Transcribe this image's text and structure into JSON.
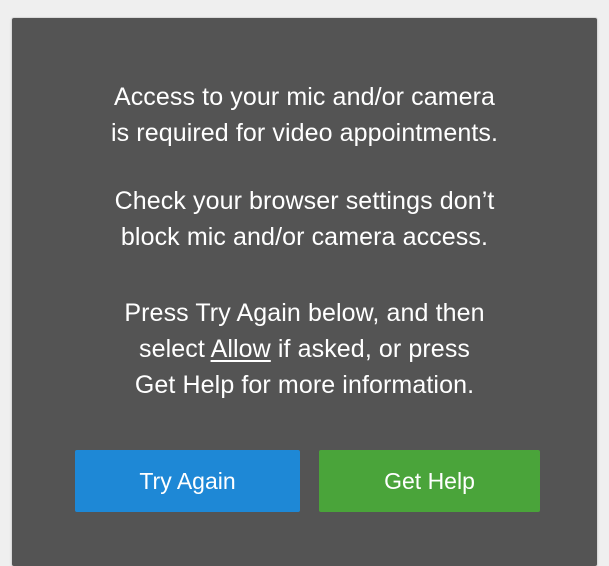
{
  "dialog": {
    "paragraph1": {
      "line1": "Access to your mic and/or camera",
      "line2": "is required for video appointments."
    },
    "paragraph2": {
      "line1": "Check your browser settings don’t",
      "line2": "block mic and/or camera access."
    },
    "paragraph3": {
      "line1": "Press Try Again below, and then",
      "line2_prefix": "select ",
      "allow_link": "Allow",
      "line2_suffix": " if asked, or press",
      "line3": "Get Help for more information."
    },
    "buttons": {
      "try_again": "Try Again",
      "get_help": "Get Help"
    }
  },
  "colors": {
    "dialog_background": "#545454",
    "try_again_button": "#1e88d6",
    "get_help_button": "#4aa43a",
    "text": "#ffffff"
  }
}
